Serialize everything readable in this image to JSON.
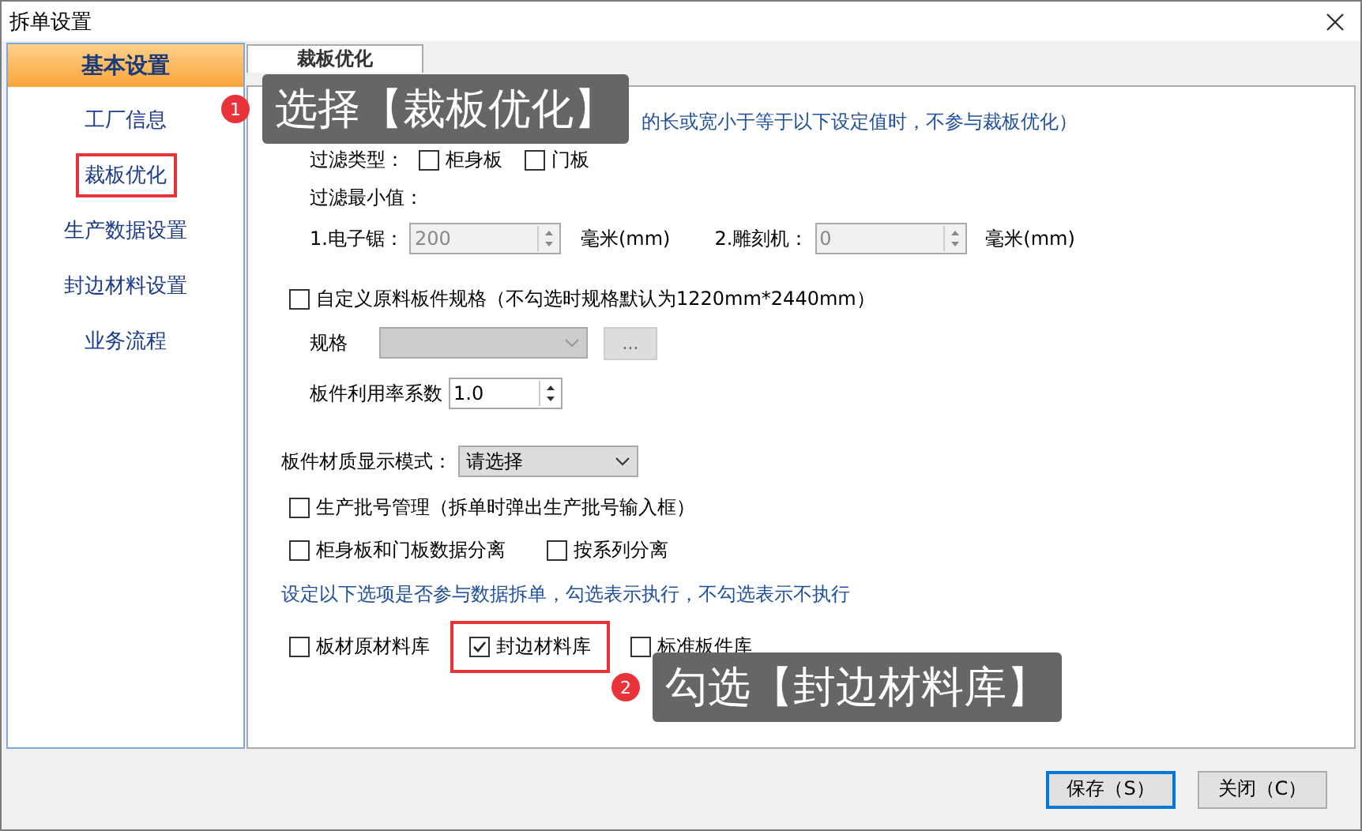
{
  "window": {
    "title": "拆单设置"
  },
  "sidebar": {
    "header": "基本设置",
    "items": [
      {
        "label": "工厂信息",
        "highlighted": false
      },
      {
        "label": "裁板优化",
        "highlighted": true
      },
      {
        "label": "生产数据设置",
        "highlighted": false
      },
      {
        "label": "封边材料设置",
        "highlighted": false
      },
      {
        "label": "业务流程",
        "highlighted": false
      }
    ]
  },
  "tabs": [
    {
      "label": "裁板优化",
      "selected": true
    }
  ],
  "panel": {
    "filter_note": "的长或宽小于等于以下设定值时，不参与裁板优化）",
    "filter_type": {
      "label": "过滤类型：",
      "options": [
        {
          "label": "柜身板",
          "checked": false
        },
        {
          "label": "门板",
          "checked": false
        }
      ]
    },
    "filter_min_label": "过滤最小值：",
    "min_values": [
      {
        "label": "1.电子锯：",
        "value": "200",
        "unit": "毫米(mm)",
        "disabled": true
      },
      {
        "label": "2.雕刻机：",
        "value": "0",
        "unit": "毫米(mm)",
        "disabled": true
      }
    ],
    "custom_spec": {
      "label": "自定义原料板件规格（不勾选时规格默认为1220mm*2440mm）",
      "checked": false
    },
    "spec": {
      "label": "规格",
      "disabled": true,
      "button": "..."
    },
    "ratio": {
      "label": "板件利用率系数",
      "value": "1.0"
    },
    "material_mode": {
      "label": "板件材质显示模式：",
      "value": "请选择"
    },
    "batch": {
      "label": "生产批号管理（拆单时弹出生产批号输入框）",
      "checked": false
    },
    "split_options": [
      {
        "label": "柜身板和门板数据分离",
        "checked": false
      },
      {
        "label": "按系列分离",
        "checked": false
      }
    ],
    "libs_note": "设定以下选项是否参与数据拆单，勾选表示执行，不勾选表示不执行",
    "libraries": [
      {
        "label": "板材原材料库",
        "checked": false,
        "highlighted": false
      },
      {
        "label": "封边材料库",
        "checked": true,
        "highlighted": true
      },
      {
        "label": "标准板件库",
        "checked": false,
        "highlighted": false
      }
    ]
  },
  "buttons": [
    {
      "label": "保存（S）",
      "default": true
    },
    {
      "label": "关闭（C）",
      "default": false
    }
  ],
  "callouts": [
    {
      "number": "1",
      "text": "选择【裁板优化】"
    },
    {
      "number": "2",
      "text": "勾选【封边材料库】"
    }
  ]
}
